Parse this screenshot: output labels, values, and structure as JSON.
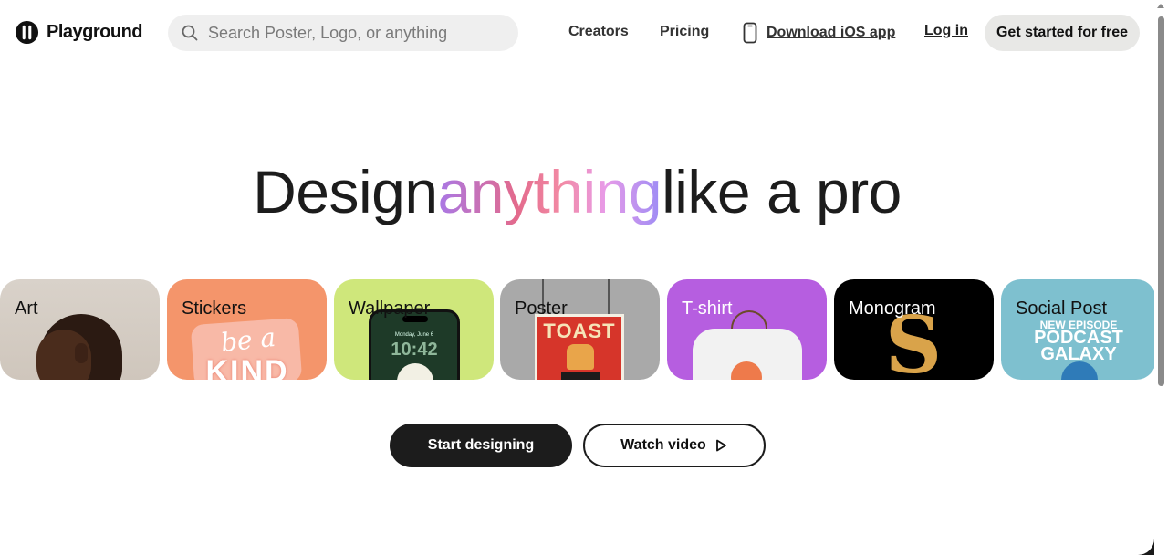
{
  "header": {
    "logo_text": "Playground",
    "search_placeholder": "Search Poster, Logo, or anything",
    "nav": {
      "creators": "Creators",
      "pricing": "Pricing",
      "ios": "Download iOS app",
      "login": "Log in",
      "cta": "Get started for free"
    }
  },
  "hero": {
    "title_before": "Design",
    "title_highlight": "anything",
    "title_after": "like a pro"
  },
  "categories": [
    {
      "label": "Art",
      "icon": "portrait-image"
    },
    {
      "label": "Stickers",
      "icon": "sticker-image"
    },
    {
      "label": "Wallpaper",
      "icon": "phone-wallpaper-image"
    },
    {
      "label": "Poster",
      "icon": "poster-image"
    },
    {
      "label": "T-shirt",
      "icon": "tshirt-image"
    },
    {
      "label": "Monogram",
      "icon": "monogram-image"
    },
    {
      "label": "Social Post",
      "icon": "social-post-image"
    }
  ],
  "card_art": {
    "stickers": {
      "line1": "be a",
      "line2": "KIND"
    },
    "wallpaper": {
      "date": "Monday, June 6",
      "time": "10:42"
    },
    "poster": {
      "title": "TOAST"
    },
    "monogram": {
      "letter": "S"
    },
    "social": {
      "line1": "NEW EPISODE",
      "line2": "PODCAST",
      "line3": "GALAXY"
    }
  },
  "actions": {
    "start": "Start designing",
    "watch": "Watch video"
  },
  "colors": {
    "accent_dark": "#1c1c1c",
    "cta_bg": "#e8e8e6",
    "search_bg": "#efefef",
    "gradient": [
      "#a978e6",
      "#e36a8c",
      "#f28aa4",
      "#e89be8",
      "#9d8cf5"
    ]
  }
}
